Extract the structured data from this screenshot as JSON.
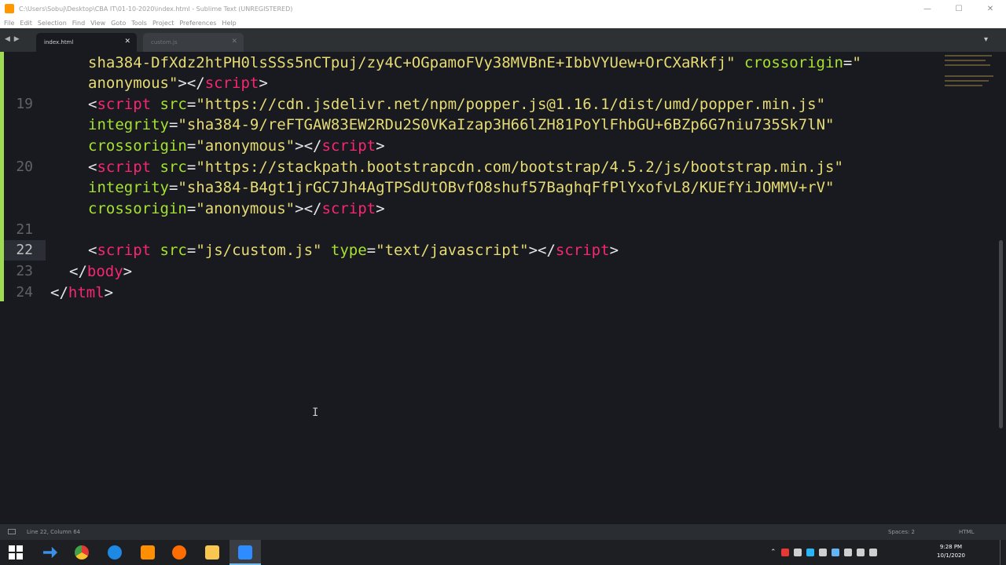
{
  "window": {
    "title": "C:\\Users\\Sobuj\\Desktop\\CBA IT\\01-10-2020\\index.html - Sublime Text (UNREGISTERED)",
    "min_glyph": "—",
    "max_glyph": "☐",
    "close_glyph": "✕"
  },
  "menu": [
    "File",
    "Edit",
    "Selection",
    "Find",
    "View",
    "Goto",
    "Tools",
    "Project",
    "Preferences",
    "Help"
  ],
  "tabs": [
    {
      "label": "index.html",
      "active": true,
      "close": "✕"
    },
    {
      "label": "custom.js",
      "active": false,
      "close": "✕"
    }
  ],
  "nav_arrows": "◀ ▶",
  "tab_overflow": "▾",
  "editor": {
    "line_numbers": [
      "19",
      "20",
      "21",
      "22",
      "23",
      "24"
    ],
    "current_line": "22",
    "lines": [
      {
        "tokens": [
          {
            "t": "sha384-DfXdz2htPH0lsSSs5nCTpuj/zy4C+OGpamoFVy38MVBnE+IbbVYUew+OrCXaRkfj\"",
            "c": "st"
          },
          {
            "t": " crossorigin",
            "c": "at"
          },
          {
            "t": "=",
            "c": "pn"
          },
          {
            "t": "\"",
            "c": "st"
          }
        ]
      },
      {
        "tokens": [
          {
            "t": "anonymous\"",
            "c": "st"
          },
          {
            "t": "></",
            "c": "pn"
          },
          {
            "t": "script",
            "c": "tg"
          },
          {
            "t": ">",
            "c": "pn"
          }
        ]
      },
      {
        "tokens": [
          {
            "t": "<",
            "c": "pn"
          },
          {
            "t": "script",
            "c": "tg"
          },
          {
            "t": " src",
            "c": "at"
          },
          {
            "t": "=",
            "c": "pn"
          },
          {
            "t": "\"https://cdn.jsdelivr.net/npm/popper.js@1.16.1/dist/umd/popper.min.js\"",
            "c": "st"
          }
        ]
      },
      {
        "tokens": [
          {
            "t": "integrity",
            "c": "at"
          },
          {
            "t": "=",
            "c": "pn"
          },
          {
            "t": "\"sha384-9/reFTGAW83EW2RDu2S0VKaIzap3H66lZH81PoYlFhbGU+6BZp6G7niu735Sk7lN\"",
            "c": "st"
          }
        ]
      },
      {
        "tokens": [
          {
            "t": "crossorigin",
            "c": "at"
          },
          {
            "t": "=",
            "c": "pn"
          },
          {
            "t": "\"anonymous\"",
            "c": "st"
          },
          {
            "t": "></",
            "c": "pn"
          },
          {
            "t": "script",
            "c": "tg"
          },
          {
            "t": ">",
            "c": "pn"
          }
        ]
      },
      {
        "tokens": [
          {
            "t": "<",
            "c": "pn"
          },
          {
            "t": "script",
            "c": "tg"
          },
          {
            "t": " src",
            "c": "at"
          },
          {
            "t": "=",
            "c": "pn"
          },
          {
            "t": "\"https://stackpath.bootstrapcdn.com/bootstrap/4.5.2/js/bootstrap.min.js\"",
            "c": "st"
          }
        ]
      },
      {
        "tokens": [
          {
            "t": "integrity",
            "c": "at"
          },
          {
            "t": "=",
            "c": "pn"
          },
          {
            "t": "\"sha384-B4gt1jrGC7Jh4AgTPSdUtOBvfO8shuf57BaghqFfPlYxofvL8/KUEfYiJOMMV+rV\"",
            "c": "st"
          }
        ]
      },
      {
        "tokens": [
          {
            "t": "crossorigin",
            "c": "at"
          },
          {
            "t": "=",
            "c": "pn"
          },
          {
            "t": "\"anonymous\"",
            "c": "st"
          },
          {
            "t": "></",
            "c": "pn"
          },
          {
            "t": "script",
            "c": "tg"
          },
          {
            "t": ">",
            "c": "pn"
          }
        ]
      },
      {
        "tokens": []
      },
      {
        "tokens": [
          {
            "t": "<",
            "c": "pn"
          },
          {
            "t": "script",
            "c": "tg"
          },
          {
            "t": " src",
            "c": "at"
          },
          {
            "t": "=",
            "c": "pn"
          },
          {
            "t": "\"js/custom.js\"",
            "c": "st"
          },
          {
            "t": " type",
            "c": "at"
          },
          {
            "t": "=",
            "c": "pn"
          },
          {
            "t": "\"text/javascript\"",
            "c": "st"
          },
          {
            "t": "></",
            "c": "pn"
          },
          {
            "t": "script",
            "c": "tg"
          },
          {
            "t": ">",
            "c": "pn"
          }
        ]
      },
      {
        "tokens": [
          {
            "t": "</",
            "c": "pn"
          },
          {
            "t": "body",
            "c": "tg"
          },
          {
            "t": ">",
            "c": "pn"
          }
        ]
      },
      {
        "tokens": [
          {
            "t": "</",
            "c": "pn"
          },
          {
            "t": "html",
            "c": "tg"
          },
          {
            "t": ">",
            "c": "pn"
          }
        ]
      }
    ],
    "text_cursor_glyph": "I"
  },
  "status": {
    "position": "Line 22, Column 64",
    "spaces": "Spaces: 2",
    "syntax": "HTML"
  },
  "taskbar": {
    "clock_time": "9:28 PM",
    "clock_date": "10/1/2020"
  },
  "colors": {
    "tag": "#f92672",
    "attribute": "#a6e22e",
    "string": "#e6db74",
    "background": "#181a1f"
  }
}
